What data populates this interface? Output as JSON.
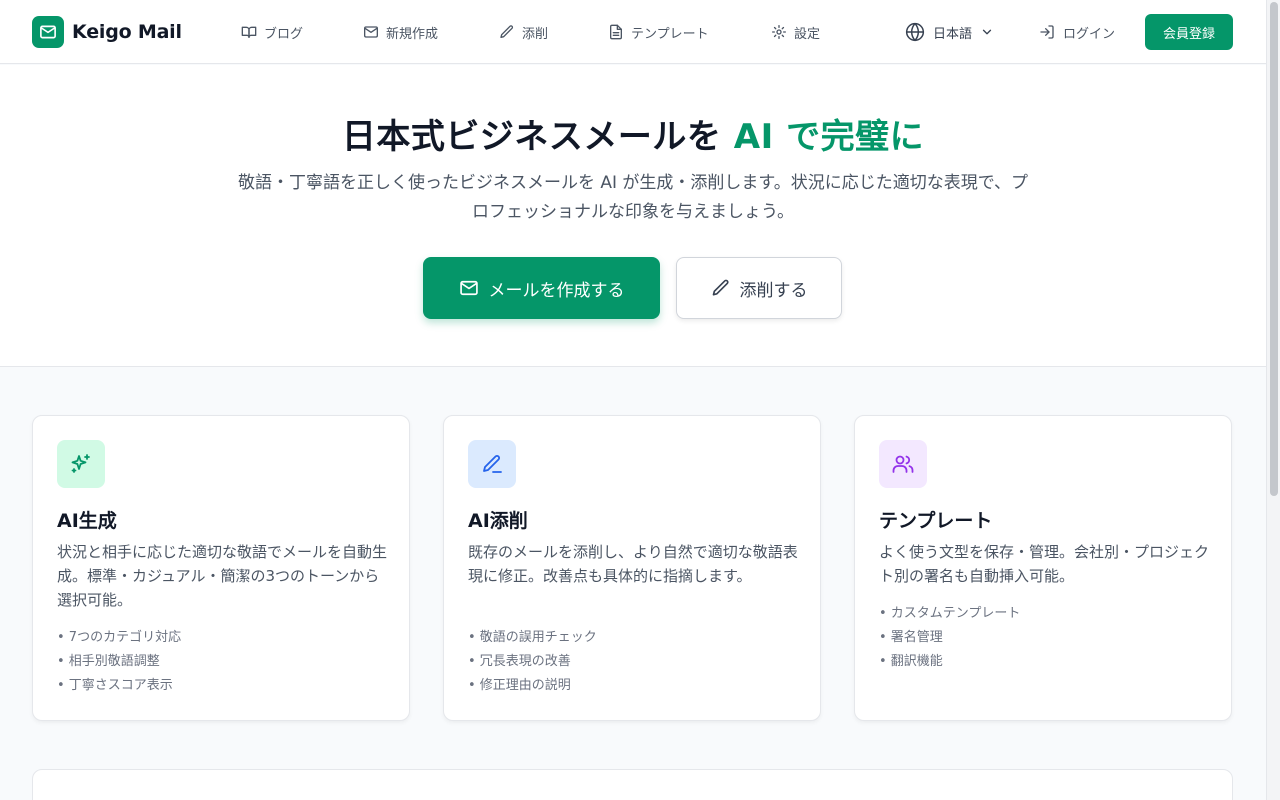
{
  "brand": {
    "name": "Keigo Mail",
    "accent": "#059669"
  },
  "nav": [
    {
      "icon": "book-icon",
      "label": "ブログ"
    },
    {
      "icon": "mail-icon",
      "label": "新規作成"
    },
    {
      "icon": "pen-icon",
      "label": "添削"
    },
    {
      "icon": "document-icon",
      "label": "テンプレート"
    },
    {
      "icon": "gear-icon",
      "label": "設定"
    }
  ],
  "header": {
    "language": "日本語",
    "login": "ログイン",
    "signup": "会員登録"
  },
  "hero": {
    "title_main": "日本式ビジネスメールを ",
    "title_accent": "AI で完璧に",
    "subtitle": "敬語・丁寧語を正しく使ったビジネスメールを AI が生成・添削します。状況に応じた適切な表現で、プロフェッショナルな印象を与えましょう。",
    "primary_button": "メールを作成する",
    "secondary_button": "添削する"
  },
  "features": [
    {
      "icon": "sparkles-icon",
      "title": "AI生成",
      "description": "状況と相手に応じた適切な敬語でメールを自動生成。標準・カジュアル・簡潔の3つのトーンから選択可能。",
      "points": [
        "• 7つのカテゴリ対応",
        "• 相手別敬語調整",
        "• 丁寧さスコア表示"
      ]
    },
    {
      "icon": "pen-line-icon",
      "title": "AI添削",
      "description": "既存のメールを添削し、より自然で適切な敬語表現に修正。改善点も具体的に指摘します。",
      "points": [
        "• 敬語の誤用チェック",
        "• 冗長表現の改善",
        "• 修正理由の説明"
      ]
    },
    {
      "icon": "users-icon",
      "title": "テンプレート",
      "description": "よく使う文型を保存・管理。会社別・プロジェクト別の署名も自動挿入可能。",
      "points": [
        "• カスタムテンプレート",
        "• 署名管理",
        "• 翻訳機能"
      ]
    }
  ]
}
